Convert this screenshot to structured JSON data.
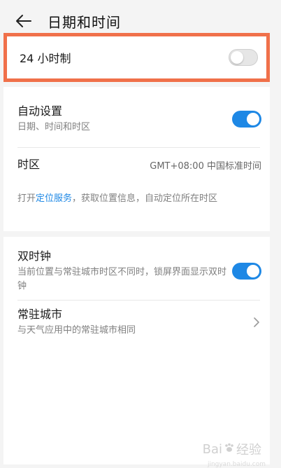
{
  "header": {
    "title": "日期和时间"
  },
  "row_24h": {
    "label": "24 小时制",
    "enabled": false
  },
  "auto_settings": {
    "title": "自动设置",
    "subtitle": "日期、时间和时区",
    "enabled": true
  },
  "timezone": {
    "title": "时区",
    "value": "GMT+08:00 中国标准时间"
  },
  "location_note": {
    "prefix": "打开",
    "link": "定位服务",
    "suffix": "，获取位置信息，自动定位所在时区"
  },
  "dual_clock": {
    "title": "双时钟",
    "subtitle": "当前位置与常驻城市时区不同时，锁屏界面显示双时钟",
    "enabled": true
  },
  "home_city": {
    "title": "常驻城市",
    "subtitle": "与天气应用中的常驻城市相同"
  },
  "watermark": {
    "brand_a": "Bai",
    "brand_b": "经验",
    "url": "jingyan.baidu.com"
  },
  "colors": {
    "accent": "#1e88e5",
    "highlight_border": "#f0704a"
  },
  "icons": {
    "back": "arrow-left-icon",
    "chevron": "chevron-right-icon"
  }
}
